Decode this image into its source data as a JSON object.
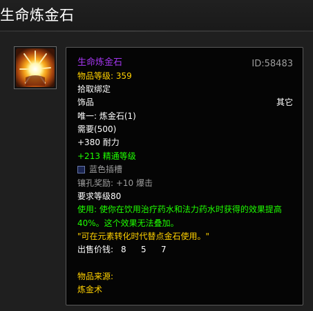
{
  "page": {
    "title": "生命炼金石"
  },
  "item": {
    "name": "生命炼金石",
    "id": "ID:58483",
    "item_level": "物品等级: 359",
    "bind": "拾取绑定",
    "slot": "饰品",
    "slot_type": "其它",
    "unique": "唯一: 炼金石(1)",
    "requirement": "需要(500)",
    "stat_stamina": "+380 耐力",
    "stat_mastery": "+213 精通等级",
    "socket": "蓝色插槽",
    "socket_bonus": "镶孔奖励: +10 爆击",
    "required_level": "要求等级80",
    "use_line1": "使用: 使你在饮用治疗药水和法力药水时获得的效果提高",
    "use_line2": "40%。这个效果无法叠加。",
    "flavor": "\"可在元素转化时代替点金石使用。\"",
    "sell_label": "出售价钱:",
    "sell_gold": "8",
    "sell_silver": "5",
    "sell_copper": "7",
    "source_label": "物品来源:",
    "source_value": "炼金术"
  },
  "colors": {
    "epic": "#a335ee",
    "gold": "#ffd100",
    "green": "#1eff00",
    "gray": "#9d9d9d"
  },
  "icons": {
    "item_icon": "alchemist-stone-icon",
    "socket_icon": "blue-socket-icon"
  }
}
